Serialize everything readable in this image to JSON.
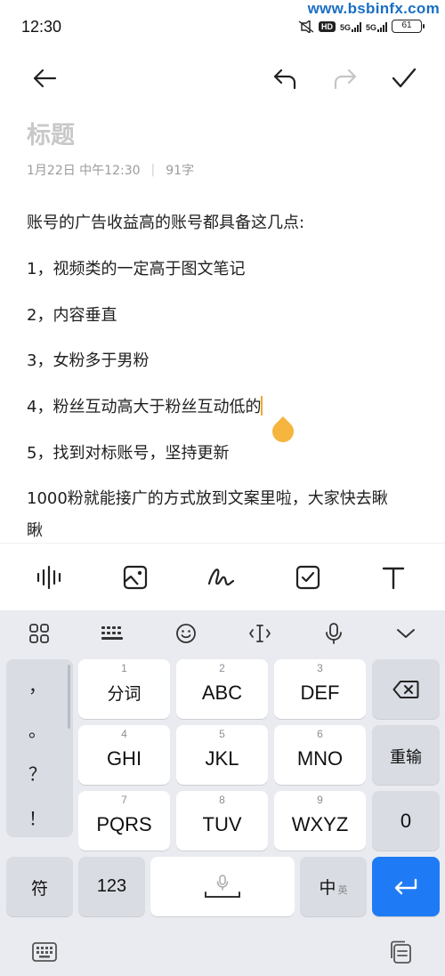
{
  "status": {
    "time": "12:30",
    "watermark": "www.bsbinfx.com",
    "hd": "HD",
    "sig1": "5G",
    "sig2": "5G",
    "battery": "61"
  },
  "toolbar": {
    "back_icon": "arrow-left-icon",
    "undo_icon": "undo-icon",
    "redo_icon": "redo-icon",
    "done_icon": "checkmark-icon"
  },
  "note": {
    "title_placeholder": "标题",
    "date": "1月22日 中午12:30",
    "separator": "|",
    "word_count": "91字",
    "lines": [
      "账号的广告收益高的账号都具备这几点:",
      "1，视频类的一定高于图文笔记",
      "2，内容垂直",
      "3，女粉多于男粉",
      "4，粉丝互动高大于粉丝互动低的",
      "5，找到对标账号，坚持更新",
      "1000粉就能接广的方式放到文案里啦，大家快去瞅",
      "瞅"
    ]
  },
  "format_bar": {
    "icons": [
      "audio-wave-icon",
      "image-icon",
      "handwriting-icon",
      "checkbox-icon",
      "text-format-icon"
    ]
  },
  "keyboard": {
    "top_icons": [
      "apps-grid-icon",
      "keyboard-icon",
      "emoji-icon",
      "cursor-move-icon",
      "microphone-icon",
      "chevron-down-icon"
    ],
    "symbols": [
      "，",
      "。",
      "？",
      "！"
    ],
    "keys": {
      "k1": {
        "num": "1",
        "label": "分词"
      },
      "k2": {
        "num": "2",
        "label": "ABC"
      },
      "k3": {
        "num": "3",
        "label": "DEF"
      },
      "k4": {
        "num": "4",
        "label": "GHI"
      },
      "k5": {
        "num": "5",
        "label": "JKL"
      },
      "k6": {
        "num": "6",
        "label": "MNO"
      },
      "k7": {
        "num": "7",
        "label": "PQRS"
      },
      "k8": {
        "num": "8",
        "label": "TUV"
      },
      "k9": {
        "num": "9",
        "label": "WXYZ"
      },
      "reenter": "重输",
      "zero": "0",
      "fu": "符",
      "num123": "123",
      "zh": "中",
      "en": "英"
    },
    "bottom_icons": [
      "keyboard-switch-icon",
      "clipboard-icon"
    ]
  }
}
